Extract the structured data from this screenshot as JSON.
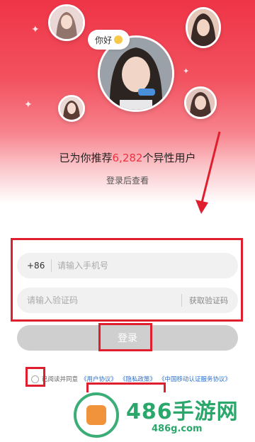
{
  "greeting": {
    "text": "你好"
  },
  "headline": {
    "prefix": "已为你推荐",
    "count": "6,282",
    "suffix": "个异性用户"
  },
  "subline": "登录后查看",
  "phone": {
    "country_code": "+86",
    "placeholder": "请输入手机号"
  },
  "code": {
    "placeholder": "请输入验证码",
    "get_code_label": "获取验证码"
  },
  "login_button": "登录",
  "agreement": {
    "prefix": "已阅读并同意",
    "links": [
      "《用户协议》",
      "《隐私政策》",
      "《中国移动认证服务协议》"
    ]
  },
  "watermark": {
    "big": "486手游网",
    "small": "486g.com"
  },
  "colors": {
    "accent": "#f0313f",
    "annotation": "#e01f2e",
    "watermark": "#2aa86b"
  }
}
